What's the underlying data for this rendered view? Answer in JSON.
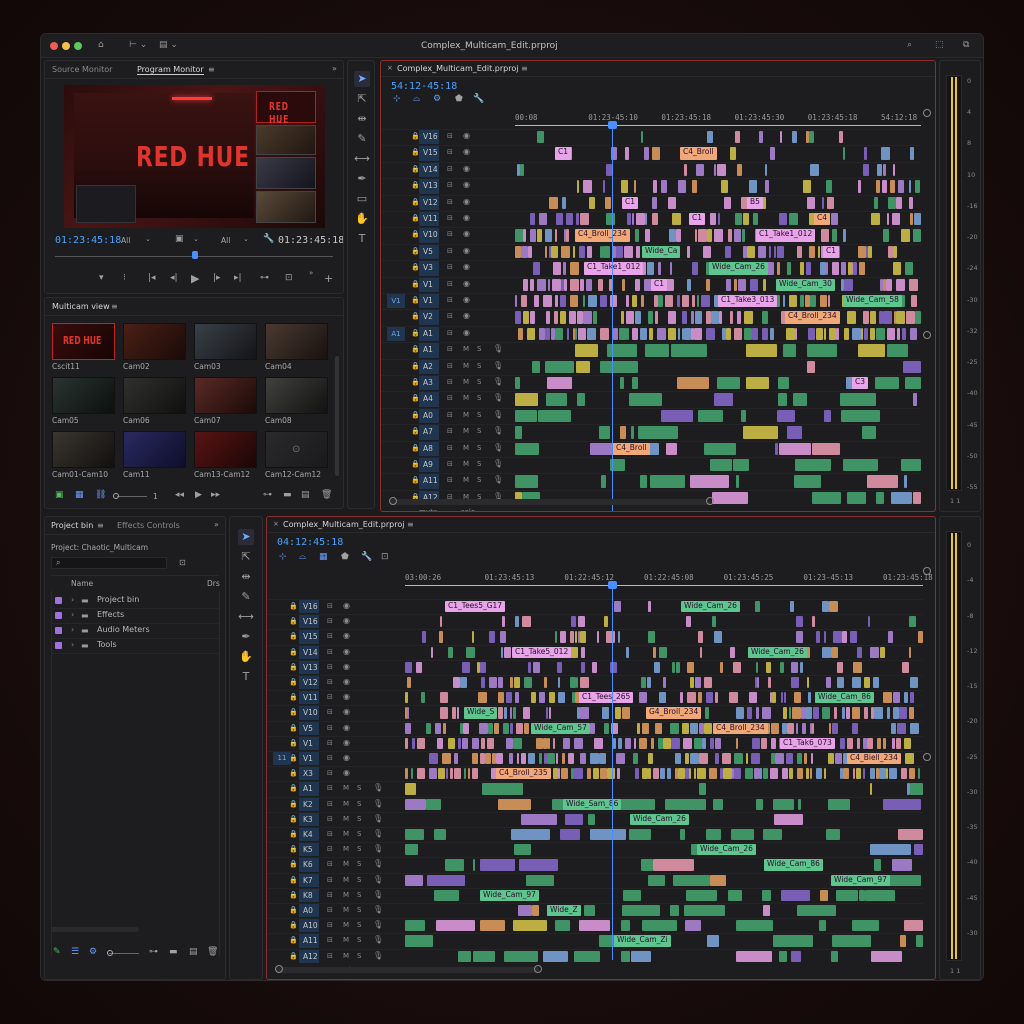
{
  "window": {
    "title": "Complex_Multicam_Edit.prproj"
  },
  "source_monitor": {
    "tabs": [
      "Source Monitor",
      "Program Monitor"
    ],
    "overlay_title": "RED HUE",
    "pip_title": "RED HUE",
    "timecode_left": "01:23:45:18",
    "timecode_right": "01:23:45:18",
    "fit": "All",
    "quality": "All"
  },
  "multicam": {
    "tab": "Multicam view",
    "first_title": "RED HUE",
    "cams": [
      "Cscit11",
      "Cam02",
      "Cam03",
      "Cam04",
      "Cam05",
      "Cam06",
      "Cam07",
      "Cam08",
      "Cam01-Cam10",
      "Cam11",
      "Cam13-Cam12",
      "Cam12-Cam12"
    ],
    "zoom_value": "1"
  },
  "timeline_top": {
    "title": "Complex_Multicam_Edit.prproj",
    "timecode": "54:12-45:18",
    "ruler": [
      "00:08",
      "01:23-45:10",
      "01:23:45:18",
      "01:23:45:30",
      "01:23:45:18",
      "54:12:18"
    ],
    "video_tracks": [
      "V16",
      "V15",
      "V14",
      "V13",
      "V12",
      "V11",
      "V10",
      "V5",
      "V3",
      "V1",
      "V1",
      "V2",
      "A1"
    ],
    "audio_tracks": [
      "A1",
      "A2",
      "A3",
      "A4",
      "A0",
      "A7",
      "A8",
      "A9",
      "A11",
      "A12"
    ],
    "source_patch": [
      "V1",
      "A1"
    ],
    "footer": [
      "mute",
      "solo"
    ],
    "labels": [
      "C1",
      "C1",
      "C1",
      "C1_Take1_012",
      "C1",
      "C1_Take1_012",
      "C1",
      "C1_Take3_013",
      "C4_Broll_234",
      "C3",
      "C4_Broll",
      "C4_Broll",
      "B5",
      "C4",
      "C4_Broll_234",
      "Wide_Ca",
      "Wide_Cam_26",
      "Wide_Cam_30",
      "Wide_Cam_58"
    ]
  },
  "project_panel": {
    "tabs": [
      "Project bin",
      "Effects Controls"
    ],
    "project": "Project: Chaotic_Multicam",
    "search_placeholder": "",
    "columns": [
      "Name",
      "Drs"
    ],
    "items": [
      "Project bin",
      "Effects",
      "Audio Meters",
      "Tools"
    ]
  },
  "timeline_bottom": {
    "title": "Complex_Multicam_Edit.prproj",
    "timecode": "04:12:45:18",
    "ruler": [
      "03:00:26",
      "01:23:45:13",
      "01:22:45:12",
      "01:22:45:08",
      "01:23:45:25",
      "01:23-45:13",
      "01:23:45:18"
    ],
    "video_tracks": [
      "V16",
      "V16",
      "V15",
      "V14",
      "V13",
      "V12",
      "V11",
      "V10",
      "V5",
      "V1",
      "V1",
      "X3"
    ],
    "audio_tracks": [
      "A1",
      "K2",
      "K3",
      "K4",
      "K5",
      "K6",
      "K7",
      "K8",
      "A0",
      "A10",
      "A11",
      "A12"
    ],
    "source_patch": [
      "11"
    ],
    "footer": [
      "mute",
      "solo"
    ],
    "labels": [
      "C1_Tees5_G17",
      "C1_Take5_012",
      "C1_Tees_265",
      "G4_Broll_234",
      "C4_Broll_234",
      "C1_Tak6_073",
      "C4_Biell_234",
      "C4_Broll_235",
      "Wide_Sam_86",
      "Wide_Cam_26",
      "Wide_Cam_26",
      "Wide_Cam_86",
      "Wide_Cam_97",
      "Wide_Cam_97",
      "Wide_Z",
      "Wide_Cam_Zi",
      "Wide_Cam_26",
      "Wide_Cam_26",
      "Wide_Cam_86",
      "Wide_S",
      "Wide_Cam_57"
    ]
  },
  "meters": {
    "top_scale": [
      "0",
      "4",
      "8",
      "10",
      "-16",
      "-20",
      "-24",
      "-30",
      "-32",
      "-25",
      "-40",
      "-45",
      "-50",
      "-55"
    ],
    "bottom_scale": [
      "0",
      "-4",
      "-8",
      "-12",
      "-15",
      "-20",
      "-25",
      "-30",
      "-35",
      "-40",
      "-45",
      "-30"
    ],
    "top_foot": "1 1",
    "bottom_foot": "1 1"
  },
  "colors": {
    "accent": "#4a8fff",
    "active_border": "#8a2f2f",
    "clip_pink": "#e6a0e6",
    "clip_violet": "#b58ae0",
    "clip_blue": "#7ea8e0",
    "clip_green": "#46a872",
    "clip_orange": "#e6a060",
    "clip_yellow": "#d8c84a",
    "title_red": "#e0352c"
  }
}
